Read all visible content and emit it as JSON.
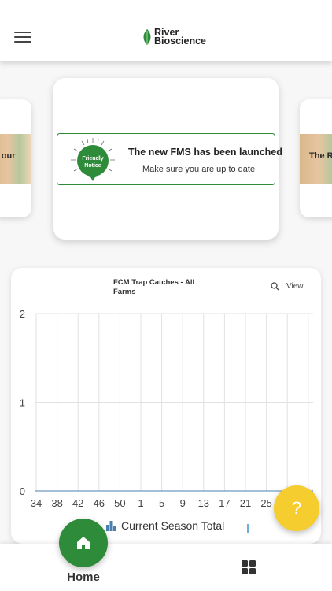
{
  "app": {
    "logo_line1": "River",
    "logo_line2": "Bioscience"
  },
  "carousel": {
    "left_card_text": "p our",
    "right_card_text": "The R",
    "notice": {
      "badge_line1": "Friendly",
      "badge_line2": "Notice",
      "title": "The new FMS has been launched",
      "subtitle": "Make sure you are up to date"
    }
  },
  "chart_card": {
    "title": "FCM Trap Catches - All Farms",
    "view_label": "View",
    "legend_label": "Current Season Total"
  },
  "chart_data": {
    "type": "bar",
    "title": "FCM Trap Catches - All Farms",
    "categories": [
      "34",
      "38",
      "42",
      "46",
      "50",
      "1",
      "5",
      "9",
      "13",
      "17",
      "21",
      "25"
    ],
    "series": [
      {
        "name": "Current Season Total",
        "values": [
          0,
          0,
          0,
          0,
          0,
          0,
          0,
          0,
          0,
          0,
          0,
          0
        ]
      }
    ],
    "y_ticks": [
      "0",
      "1",
      "2"
    ],
    "ylim": [
      0,
      2
    ],
    "grid": true,
    "legend_position": "bottom",
    "colors": {
      "series": "#6ab0d8",
      "grid": "#e2e2e2"
    }
  },
  "help": {
    "label": "?"
  },
  "bottom_nav": {
    "home_label": "Home",
    "home_icon": "home-icon",
    "apps_icon": "grid-icon"
  },
  "colors": {
    "brand_green": "#2e8b3a",
    "help_yellow": "#f6cd2e"
  }
}
